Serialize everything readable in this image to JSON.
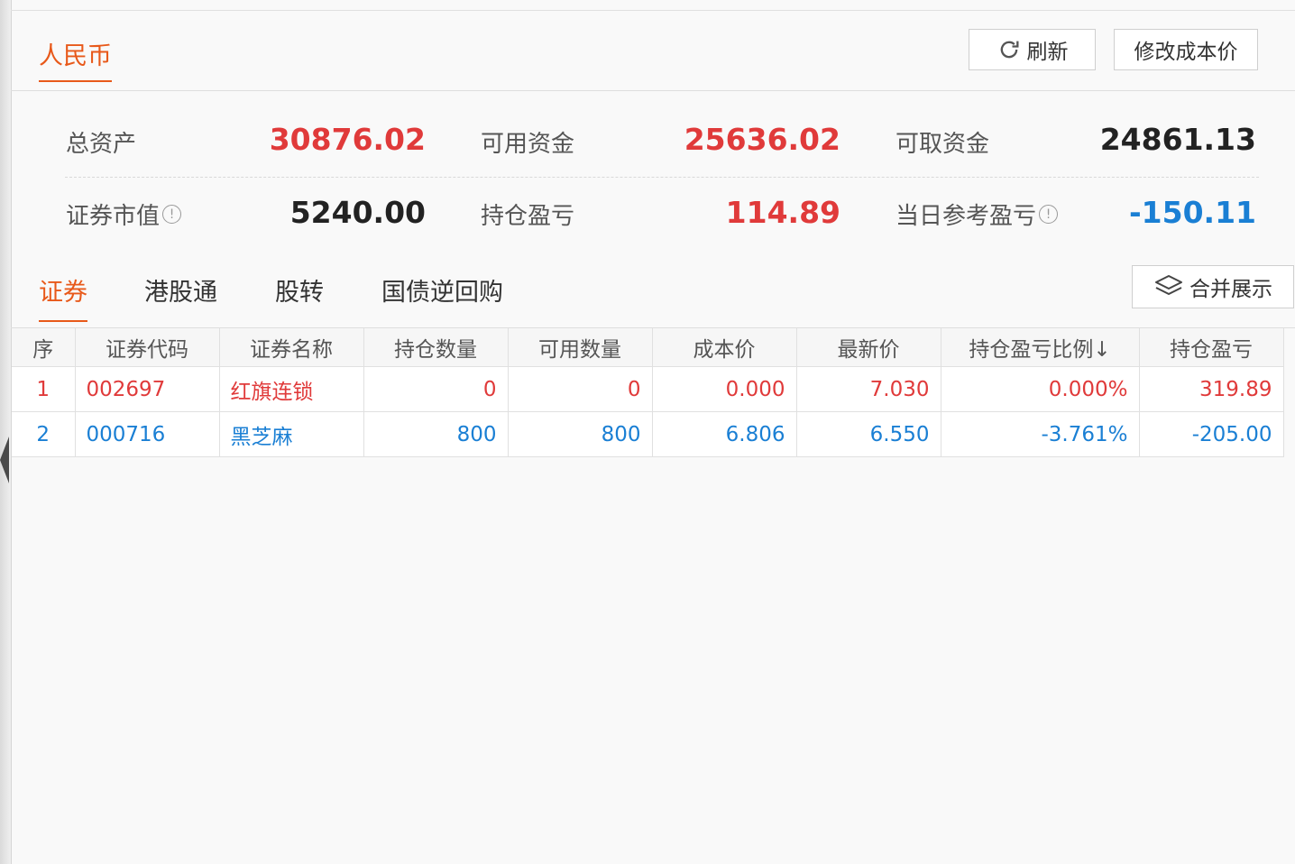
{
  "currency_tab": "人民币",
  "buttons": {
    "refresh": "刷新",
    "edit_cost": "修改成本价",
    "merge_view": "合并展示"
  },
  "summary": {
    "total_assets_label": "总资产",
    "total_assets_value": "30876.02",
    "available_funds_label": "可用资金",
    "available_funds_value": "25636.02",
    "withdrawable_label": "可取资金",
    "withdrawable_value": "24861.13",
    "market_value_label": "证券市值",
    "market_value_value": "5240.00",
    "position_pl_label": "持仓盈亏",
    "position_pl_value": "114.89",
    "daily_pl_label": "当日参考盈亏",
    "daily_pl_value": "-150.11"
  },
  "tabs": [
    "证券",
    "港股通",
    "股转",
    "国债逆回购"
  ],
  "table": {
    "headers": [
      "序",
      "证券代码",
      "证券名称",
      "持仓数量",
      "可用数量",
      "成本价",
      "最新价",
      "持仓盈亏比例↓",
      "持仓盈亏"
    ],
    "rows": [
      {
        "seq": "1",
        "code": "002697",
        "name": "红旗连锁",
        "qty": "0",
        "avail": "0",
        "cost": "0.000",
        "last": "7.030",
        "pl_pct": "0.000%",
        "pl": "319.89",
        "trend": "up"
      },
      {
        "seq": "2",
        "code": "000716",
        "name": "黑芝麻",
        "qty": "800",
        "avail": "800",
        "cost": "6.806",
        "last": "6.550",
        "pl_pct": "-3.761%",
        "pl": "-205.00",
        "trend": "down"
      }
    ]
  },
  "colors": {
    "accent": "#e8591a",
    "gain": "#e03a3a",
    "loss": "#1a7fd4"
  }
}
